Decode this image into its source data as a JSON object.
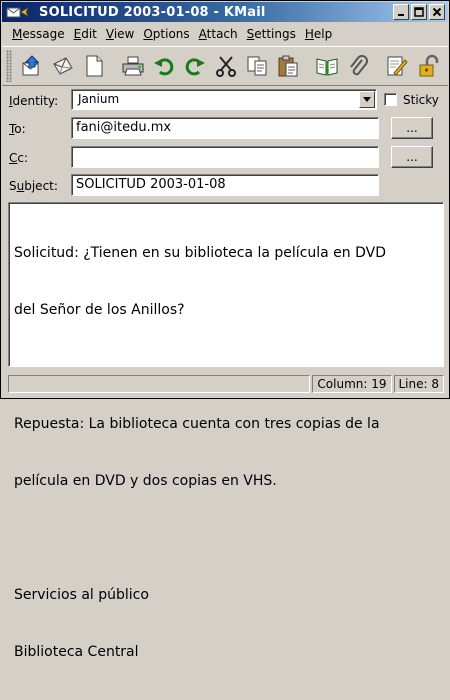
{
  "window": {
    "title": "SOLICITUD 2003-01-08 - KMail"
  },
  "menu": [
    {
      "accel": "M",
      "rest": "essage"
    },
    {
      "accel": "E",
      "rest": "dit"
    },
    {
      "accel": "V",
      "rest": "iew"
    },
    {
      "accel": "O",
      "rest": "ptions"
    },
    {
      "accel": "A",
      "rest": "ttach"
    },
    {
      "accel": "S",
      "rest": "ettings"
    },
    {
      "accel": "H",
      "rest": "elp"
    }
  ],
  "toolbar": {
    "icons": [
      "send-icon",
      "send-later-icon",
      "new-document-icon",
      "print-icon",
      "undo-icon",
      "redo-icon",
      "cut-icon",
      "copy-icon",
      "paste-icon",
      "address-book-icon",
      "attach-icon",
      "sign-icon",
      "encrypt-icon"
    ]
  },
  "header": {
    "identity_label_accel": "I",
    "identity_label_rest": "dentity:",
    "identity_value": "Janium",
    "sticky_label": "Sticky",
    "sticky_checked": false,
    "to_label_accel": "T",
    "to_label_rest": "o:",
    "to_value": "fani@itedu.mx",
    "cc_label_accel": "C",
    "cc_label_rest": "c:",
    "cc_value": "",
    "subject_label_pre": "S",
    "subject_label_accel": "u",
    "subject_label_rest": "bject:",
    "subject_value": "SOLICITUD 2003-01-08",
    "browse_label": "..."
  },
  "body": {
    "lines": [
      "Solicitud: ¿Tienen en su biblioteca la película en DVD",
      "del Señor de los Anillos?",
      "",
      "Repuesta: La biblioteca cuenta con tres copias de la",
      "película en DVD y dos copias en VHS.",
      "",
      "Servicios al público",
      "Biblioteca Central"
    ]
  },
  "status": {
    "column": "Column: 19",
    "line": "Line: 8"
  },
  "colors": {
    "titlebar_start": "#0a246a",
    "titlebar_end": "#a6caf0",
    "chrome": "#d4d0c8"
  }
}
